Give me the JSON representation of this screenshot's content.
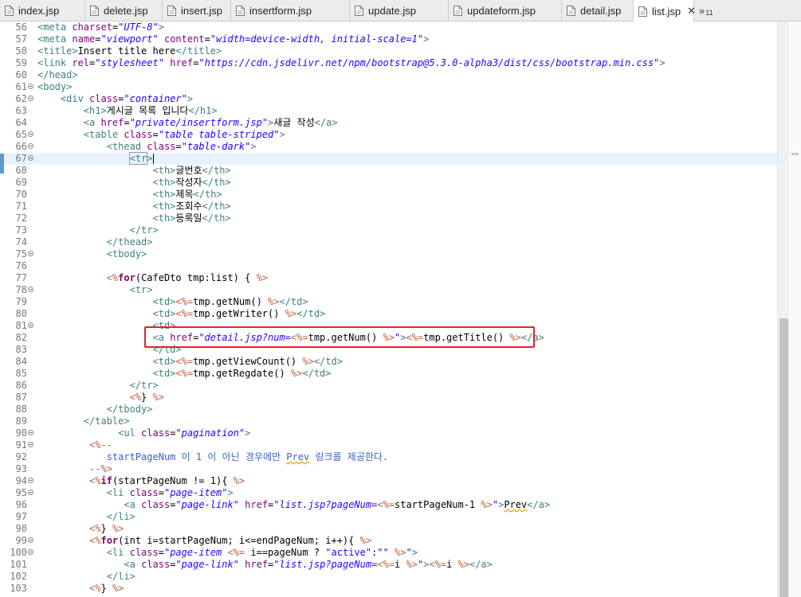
{
  "tabs": [
    {
      "label": "index.jsp",
      "active": false
    },
    {
      "label": "delete.jsp",
      "active": false
    },
    {
      "label": "insert.jsp",
      "active": false
    },
    {
      "label": "insertform.jsp",
      "active": false
    },
    {
      "label": "update.jsp",
      "active": false
    },
    {
      "label": "updateform.jsp",
      "active": false
    },
    {
      "label": "detail.jsp",
      "active": false
    },
    {
      "label": "list.jsp",
      "active": true,
      "close": "✕"
    }
  ],
  "tab_overflow": {
    "symbol": "»",
    "count": "11"
  },
  "editor": {
    "current_line": 67,
    "highlighted_line": 82,
    "lines": [
      {
        "n": "56",
        "tokens": [
          [
            "tag",
            "<meta "
          ],
          [
            "attr",
            "charset"
          ],
          [
            "txt",
            "="
          ],
          [
            "val",
            "\"UTF-8\""
          ],
          [
            "tag",
            ">"
          ]
        ]
      },
      {
        "n": "57",
        "tokens": [
          [
            "tag",
            "<meta "
          ],
          [
            "attr",
            "name"
          ],
          [
            "txt",
            "="
          ],
          [
            "val",
            "\"viewport\""
          ],
          [
            "txt",
            " "
          ],
          [
            "attr",
            "content"
          ],
          [
            "txt",
            "="
          ],
          [
            "val",
            "\"width=device-width, initial-scale=1\""
          ],
          [
            "tag",
            ">"
          ]
        ]
      },
      {
        "n": "58",
        "tokens": [
          [
            "tag",
            "<title>"
          ],
          [
            "txt",
            "Insert title here"
          ],
          [
            "tag",
            "</title>"
          ]
        ]
      },
      {
        "n": "59",
        "tokens": [
          [
            "tag",
            "<link "
          ],
          [
            "attr",
            "rel"
          ],
          [
            "txt",
            "="
          ],
          [
            "val",
            "\"stylesheet\""
          ],
          [
            "txt",
            " "
          ],
          [
            "attr",
            "href"
          ],
          [
            "txt",
            "="
          ],
          [
            "val",
            "\"https://cdn.jsdelivr.net/npm/bootstrap@5.3.0-alpha3/dist/css/bootstrap.min.css\""
          ],
          [
            "tag",
            ">"
          ]
        ]
      },
      {
        "n": "60",
        "tokens": [
          [
            "tag",
            "</head>"
          ]
        ]
      },
      {
        "n": "61",
        "fold": true,
        "tokens": [
          [
            "tag",
            "<body>"
          ]
        ]
      },
      {
        "n": "62",
        "fold": true,
        "tokens": [
          [
            "txt",
            "    "
          ],
          [
            "tag",
            "<div "
          ],
          [
            "attr",
            "class"
          ],
          [
            "txt",
            "="
          ],
          [
            "val",
            "\"container\""
          ],
          [
            "tag",
            ">"
          ]
        ]
      },
      {
        "n": "63",
        "tokens": [
          [
            "txt",
            "        "
          ],
          [
            "tag",
            "<h1>"
          ],
          [
            "txt",
            "게시글 목록 입니다"
          ],
          [
            "tag",
            "</h1>"
          ]
        ]
      },
      {
        "n": "64",
        "tokens": [
          [
            "txt",
            "        "
          ],
          [
            "tag",
            "<a "
          ],
          [
            "attr",
            "href"
          ],
          [
            "txt",
            "="
          ],
          [
            "val",
            "\"private/insertform.jsp\""
          ],
          [
            "tag",
            ">"
          ],
          [
            "txt",
            "새글 작성"
          ],
          [
            "tag",
            "</a>"
          ]
        ]
      },
      {
        "n": "65",
        "fold": true,
        "tokens": [
          [
            "txt",
            "        "
          ],
          [
            "tag",
            "<table "
          ],
          [
            "attr",
            "class"
          ],
          [
            "txt",
            "="
          ],
          [
            "val",
            "\"table table-striped\""
          ],
          [
            "tag",
            ">"
          ]
        ]
      },
      {
        "n": "66",
        "fold": true,
        "tokens": [
          [
            "txt",
            "            "
          ],
          [
            "tag",
            "<thead "
          ],
          [
            "attr",
            "class"
          ],
          [
            "txt",
            "="
          ],
          [
            "val",
            "\"table-dark\""
          ],
          [
            "tag",
            ">"
          ]
        ]
      },
      {
        "n": "67",
        "fold": true,
        "current": true,
        "tokens": [
          [
            "txt",
            "                "
          ],
          [
            "box",
            "<tr"
          ],
          [
            "tag",
            ">"
          ],
          [
            "caret",
            ""
          ]
        ]
      },
      {
        "n": "68",
        "tokens": [
          [
            "txt",
            "                    "
          ],
          [
            "tag",
            "<th>"
          ],
          [
            "txt",
            "글번호"
          ],
          [
            "tag",
            "</th>"
          ]
        ]
      },
      {
        "n": "69",
        "tokens": [
          [
            "txt",
            "                    "
          ],
          [
            "tag",
            "<th>"
          ],
          [
            "txt",
            "작성자"
          ],
          [
            "tag",
            "</th>"
          ]
        ]
      },
      {
        "n": "70",
        "tokens": [
          [
            "txt",
            "                    "
          ],
          [
            "tag",
            "<th>"
          ],
          [
            "txt",
            "제목"
          ],
          [
            "tag",
            "</th>"
          ]
        ]
      },
      {
        "n": "71",
        "tokens": [
          [
            "txt",
            "                    "
          ],
          [
            "tag",
            "<th>"
          ],
          [
            "txt",
            "조회수"
          ],
          [
            "tag",
            "</th>"
          ]
        ]
      },
      {
        "n": "72",
        "tokens": [
          [
            "txt",
            "                    "
          ],
          [
            "tag",
            "<th>"
          ],
          [
            "txt",
            "등록일"
          ],
          [
            "tag",
            "</th>"
          ]
        ]
      },
      {
        "n": "73",
        "tokens": [
          [
            "txt",
            "                "
          ],
          [
            "tag",
            "</tr>"
          ]
        ]
      },
      {
        "n": "74",
        "tokens": [
          [
            "txt",
            "            "
          ],
          [
            "tag",
            "</thead>"
          ]
        ]
      },
      {
        "n": "75",
        "fold": true,
        "tokens": [
          [
            "txt",
            "            "
          ],
          [
            "tag",
            "<tbody>"
          ]
        ]
      },
      {
        "n": "76",
        "tokens": [
          [
            "txt",
            ""
          ]
        ]
      },
      {
        "n": "77",
        "tokens": [
          [
            "txt",
            "            "
          ],
          [
            "jsp",
            "<%"
          ],
          [
            "kw",
            "for"
          ],
          [
            "java",
            "(CafeDto tmp:list) { "
          ],
          [
            "jsp",
            "%>"
          ]
        ]
      },
      {
        "n": "78",
        "fold": true,
        "tokens": [
          [
            "txt",
            "                "
          ],
          [
            "tag",
            "<tr>"
          ]
        ]
      },
      {
        "n": "79",
        "tokens": [
          [
            "txt",
            "                    "
          ],
          [
            "tag",
            "<td>"
          ],
          [
            "jsp",
            "<%="
          ],
          [
            "java",
            "tmp.getNum() "
          ],
          [
            "jsp",
            "%>"
          ],
          [
            "tag",
            "</td>"
          ]
        ]
      },
      {
        "n": "80",
        "tokens": [
          [
            "txt",
            "                    "
          ],
          [
            "tag",
            "<td>"
          ],
          [
            "jsp",
            "<%="
          ],
          [
            "java",
            "tmp.getWriter() "
          ],
          [
            "jsp",
            "%>"
          ],
          [
            "tag",
            "</td>"
          ]
        ]
      },
      {
        "n": "81",
        "fold": true,
        "tokens": [
          [
            "txt",
            "                    "
          ],
          [
            "tag",
            "<td>"
          ]
        ]
      },
      {
        "n": "82",
        "tokens": [
          [
            "txt",
            "                    "
          ],
          [
            "tag",
            "<a "
          ],
          [
            "attr",
            "href"
          ],
          [
            "txt",
            "="
          ],
          [
            "val",
            "\"detail.jsp?num="
          ],
          [
            "jsp",
            "<%="
          ],
          [
            "java",
            "tmp.getNum() "
          ],
          [
            "jsp",
            "%>"
          ],
          [
            "val",
            "\""
          ],
          [
            "tag",
            ">"
          ],
          [
            "jsp",
            "<%="
          ],
          [
            "java",
            "tmp.getTitle() "
          ],
          [
            "jsp",
            "%>"
          ],
          [
            "tag",
            "</a>"
          ]
        ]
      },
      {
        "n": "83",
        "tokens": [
          [
            "txt",
            "                    "
          ],
          [
            "tag",
            "</td>"
          ]
        ]
      },
      {
        "n": "84",
        "tokens": [
          [
            "txt",
            "                    "
          ],
          [
            "tag",
            "<td>"
          ],
          [
            "jsp",
            "<%="
          ],
          [
            "java",
            "tmp.getViewCount() "
          ],
          [
            "jsp",
            "%>"
          ],
          [
            "tag",
            "</td>"
          ]
        ]
      },
      {
        "n": "85",
        "tokens": [
          [
            "txt",
            "                    "
          ],
          [
            "tag",
            "<td>"
          ],
          [
            "jsp",
            "<%="
          ],
          [
            "java",
            "tmp.getRegdate() "
          ],
          [
            "jsp",
            "%>"
          ],
          [
            "tag",
            "</td>"
          ]
        ]
      },
      {
        "n": "86",
        "tokens": [
          [
            "txt",
            "                "
          ],
          [
            "tag",
            "</tr>"
          ]
        ]
      },
      {
        "n": "87",
        "tokens": [
          [
            "txt",
            "                "
          ],
          [
            "jsp",
            "<%"
          ],
          [
            "java",
            "} "
          ],
          [
            "jsp",
            "%>"
          ]
        ]
      },
      {
        "n": "88",
        "tokens": [
          [
            "txt",
            "            "
          ],
          [
            "tag",
            "</tbody>"
          ]
        ]
      },
      {
        "n": "89",
        "tokens": [
          [
            "txt",
            "        "
          ],
          [
            "tag",
            "</table>"
          ]
        ]
      },
      {
        "n": "90",
        "fold": true,
        "tokens": [
          [
            "txt",
            "              "
          ],
          [
            "tag",
            "<ul "
          ],
          [
            "attr",
            "class"
          ],
          [
            "txt",
            "="
          ],
          [
            "val",
            "\"pagination\""
          ],
          [
            "tag",
            ">"
          ]
        ]
      },
      {
        "n": "91",
        "fold": true,
        "tokens": [
          [
            "txt",
            "         "
          ],
          [
            "jsp",
            "<%--"
          ]
        ]
      },
      {
        "n": "92",
        "tokens": [
          [
            "txt",
            "            "
          ],
          [
            "com",
            "startPageNum 이 1 이 아닌 경우에만 "
          ],
          [
            "err",
            "Prev"
          ],
          [
            "com",
            " 링크를 제공한다."
          ]
        ]
      },
      {
        "n": "93",
        "tokens": [
          [
            "txt",
            "         "
          ],
          [
            "jsp",
            "--%>"
          ]
        ]
      },
      {
        "n": "94",
        "fold": true,
        "tokens": [
          [
            "txt",
            "         "
          ],
          [
            "jsp",
            "<%"
          ],
          [
            "kw",
            "if"
          ],
          [
            "java",
            "(startPageNum != 1){ "
          ],
          [
            "jsp",
            "%>"
          ]
        ]
      },
      {
        "n": "95",
        "fold": true,
        "tokens": [
          [
            "txt",
            "            "
          ],
          [
            "tag",
            "<li "
          ],
          [
            "attr",
            "class"
          ],
          [
            "txt",
            "="
          ],
          [
            "val",
            "\"page-item\""
          ],
          [
            "tag",
            ">"
          ]
        ]
      },
      {
        "n": "96",
        "tokens": [
          [
            "txt",
            "               "
          ],
          [
            "tag",
            "<a "
          ],
          [
            "attr",
            "class"
          ],
          [
            "txt",
            "="
          ],
          [
            "val",
            "\"page-link\""
          ],
          [
            "txt",
            " "
          ],
          [
            "attr",
            "href"
          ],
          [
            "txt",
            "="
          ],
          [
            "val",
            "\"list.jsp?pageNum="
          ],
          [
            "jsp",
            "<%="
          ],
          [
            "java",
            "startPageNum-1 "
          ],
          [
            "jsp",
            "%>"
          ],
          [
            "val",
            "\""
          ],
          [
            "tag",
            ">"
          ],
          [
            "bad",
            "Prev"
          ],
          [
            "tag",
            "</a>"
          ]
        ]
      },
      {
        "n": "97",
        "tokens": [
          [
            "txt",
            "            "
          ],
          [
            "tag",
            "</li>"
          ]
        ]
      },
      {
        "n": "98",
        "tokens": [
          [
            "txt",
            "         "
          ],
          [
            "jsp",
            "<%"
          ],
          [
            "java",
            "} "
          ],
          [
            "jsp",
            "%>"
          ]
        ]
      },
      {
        "n": "99",
        "fold": true,
        "tokens": [
          [
            "txt",
            "         "
          ],
          [
            "jsp",
            "<%"
          ],
          [
            "kw",
            "for"
          ],
          [
            "java",
            "(int i=startPageNum; i<=endPageNum; i++){ "
          ],
          [
            "jsp",
            "%>"
          ]
        ]
      },
      {
        "n": "100",
        "fold": true,
        "tokens": [
          [
            "txt",
            "            "
          ],
          [
            "tag",
            "<li "
          ],
          [
            "attr",
            "class"
          ],
          [
            "txt",
            "="
          ],
          [
            "val",
            "\"page-item "
          ],
          [
            "jsp",
            "<%="
          ],
          [
            "java",
            " i==pageNum ? "
          ],
          [
            "str",
            "\"active\""
          ],
          [
            "java",
            ":"
          ],
          [
            "str",
            "\"\""
          ],
          [
            "java",
            " "
          ],
          [
            "jsp",
            "%>"
          ],
          [
            "val",
            "\""
          ],
          [
            "tag",
            ">"
          ]
        ]
      },
      {
        "n": "101",
        "tokens": [
          [
            "txt",
            "               "
          ],
          [
            "tag",
            "<a "
          ],
          [
            "attr",
            "class"
          ],
          [
            "txt",
            "="
          ],
          [
            "val",
            "\"page-link\""
          ],
          [
            "txt",
            " "
          ],
          [
            "attr",
            "href"
          ],
          [
            "txt",
            "="
          ],
          [
            "val",
            "\"list.jsp?pageNum="
          ],
          [
            "jsp",
            "<%="
          ],
          [
            "java",
            "i "
          ],
          [
            "jsp",
            "%>"
          ],
          [
            "val",
            "\""
          ],
          [
            "tag",
            ">"
          ],
          [
            "jsp",
            "<%="
          ],
          [
            "java",
            "i "
          ],
          [
            "jsp",
            "%>"
          ],
          [
            "tag",
            "</a>"
          ]
        ]
      },
      {
        "n": "102",
        "tokens": [
          [
            "txt",
            "            "
          ],
          [
            "tag",
            "</li>"
          ]
        ]
      },
      {
        "n": "103",
        "tokens": [
          [
            "txt",
            "         "
          ],
          [
            "jsp",
            "<%"
          ],
          [
            "java",
            "} "
          ],
          [
            "jsp",
            "%>"
          ]
        ]
      }
    ]
  }
}
